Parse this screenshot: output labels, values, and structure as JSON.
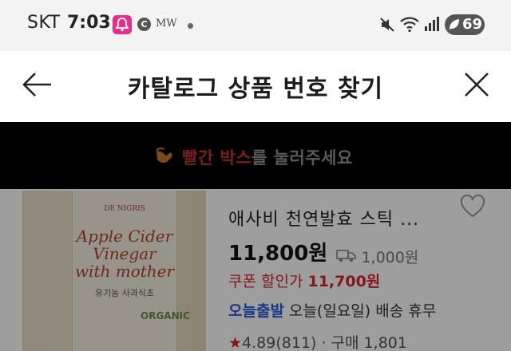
{
  "status_bar": {
    "carrier": "SKT",
    "time": "7:03",
    "c_badge": "C",
    "mw": "MW",
    "battery": "69"
  },
  "header": {
    "title": "카탈로그 상품 번호 찾기",
    "back_icon": "arrow-left-icon",
    "close_icon": "close-icon"
  },
  "hint": {
    "red_text": "빨간 박스",
    "rest_text": "를 눌러주세요"
  },
  "product": {
    "image_brand": "DE NIGRIS",
    "image_title": "Apple Cider Vinegar with mother",
    "image_sub": "유기농 사과식초",
    "image_tag": "ORGANIC",
    "name": "애사비 천연발효 스틱 ...",
    "price": "11,800원",
    "shipping_fee": "1,000원",
    "coupon_label": "쿠폰 할인가 ",
    "coupon_price": "11,700원",
    "delivery_badge": "오늘출발",
    "delivery_text": " 오늘(일요일) 배송 휴무",
    "rating_star": "★",
    "rating_text": "4.89(811) · 구매 1,801"
  },
  "colors": {
    "hint_red": "#7a1f1f",
    "coupon_red": "#d62929",
    "delivery_blue": "#2a5bd7",
    "bell_pink": "#e4308a"
  }
}
